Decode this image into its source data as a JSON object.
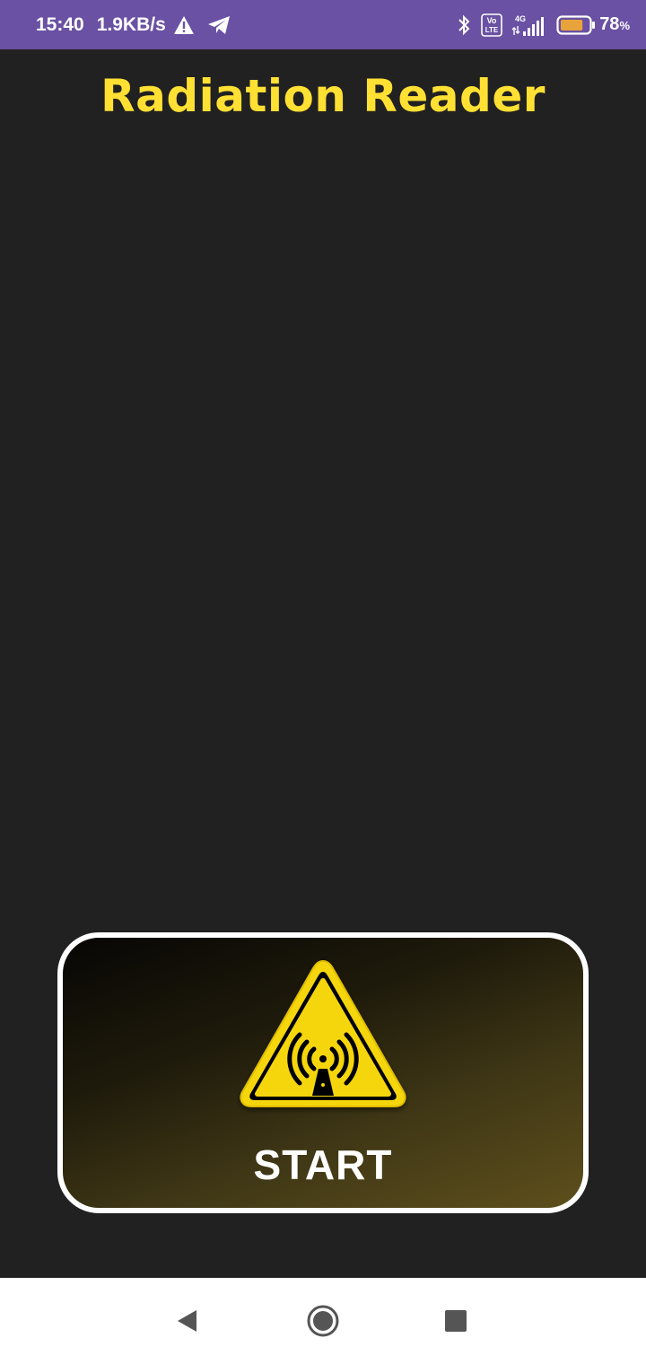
{
  "status_bar": {
    "time": "15:40",
    "network_speed": "1.9KB/s",
    "network_type": "4G",
    "volte": "Vo",
    "volte_sub": "LTE",
    "battery_percent": "78",
    "battery_unit": "%",
    "battery_level": 0.78,
    "icons": [
      "warning-icon",
      "telegram-icon",
      "bluetooth-icon",
      "volte-icon",
      "signal-icon",
      "battery-icon"
    ]
  },
  "app": {
    "title": "Radiation Reader",
    "title_color": "#ffe033"
  },
  "main": {
    "start_label": "START",
    "start_icon": "radiation-warning-icon"
  },
  "nav_bar": {
    "buttons": [
      "back-icon",
      "home-icon",
      "recents-icon"
    ]
  },
  "colors": {
    "status_bar": "#6a51a3",
    "background": "#212121",
    "accent_yellow": "#f5d60a"
  }
}
